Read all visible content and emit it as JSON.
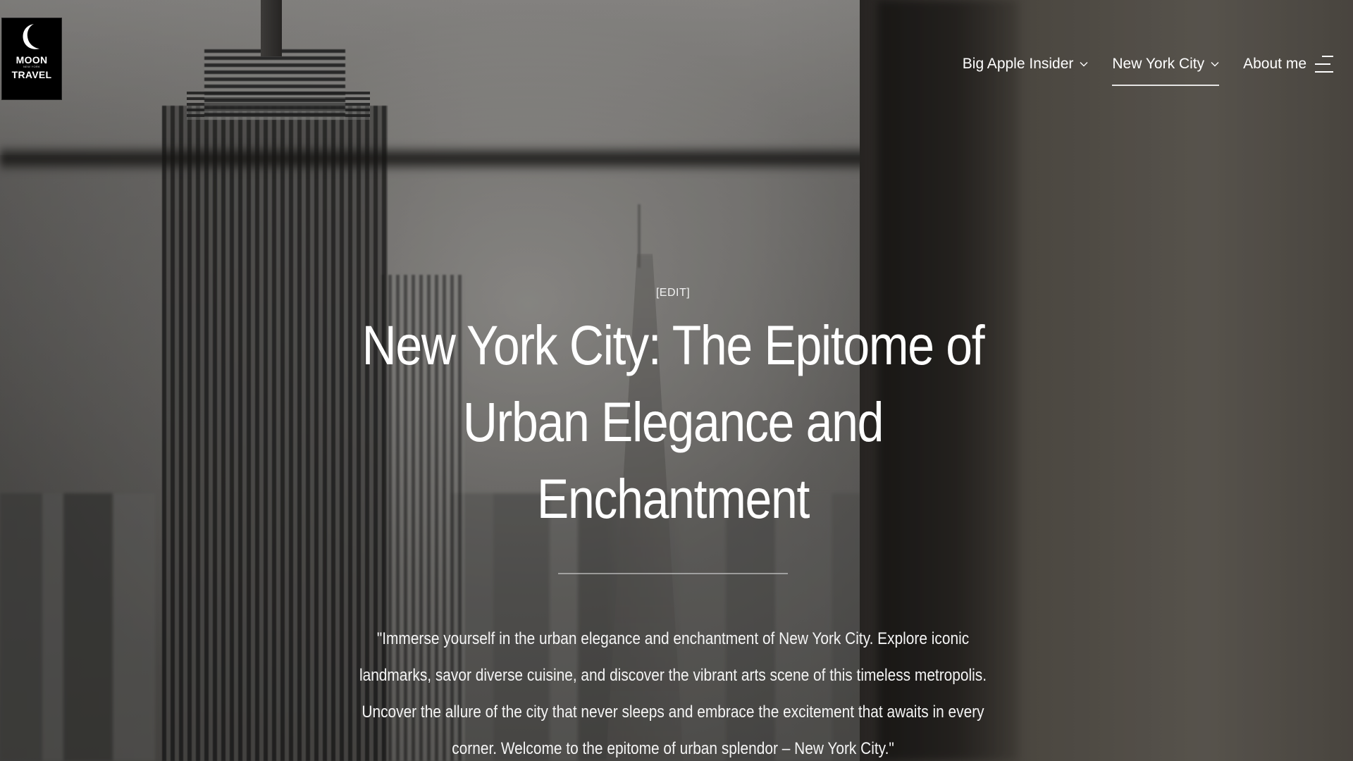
{
  "logo": {
    "line1": "MOON",
    "line2": "NEW YORK",
    "line3": "TRAVEL",
    "icon": "crescent-moon-icon"
  },
  "nav": {
    "items": [
      {
        "label": "Big Apple Insider",
        "has_dropdown": true,
        "active": false
      },
      {
        "label": "New York City",
        "has_dropdown": true,
        "active": true
      },
      {
        "label": "About me",
        "has_dropdown": false,
        "active": false
      }
    ],
    "menu_icon": "hamburger-menu-icon"
  },
  "hero": {
    "edit_label": "[EDIT]",
    "title": "New York City: The Epitome of Urban Elegance and Enchantment",
    "excerpt": "\"Immerse yourself in the urban elegance and enchantment of New York City. Explore iconic landmarks, savor diverse cuisine, and discover the vibrant arts scene of this timeless metropolis. Uncover the allure of the city that never sleeps and embrace the excitement that awaits in every corner. Welcome to the epitome of urban splendor – New York City.\""
  },
  "colors": {
    "text": "#ffffff",
    "logo_bg": "#000000",
    "divider": "#d0d0d0"
  }
}
